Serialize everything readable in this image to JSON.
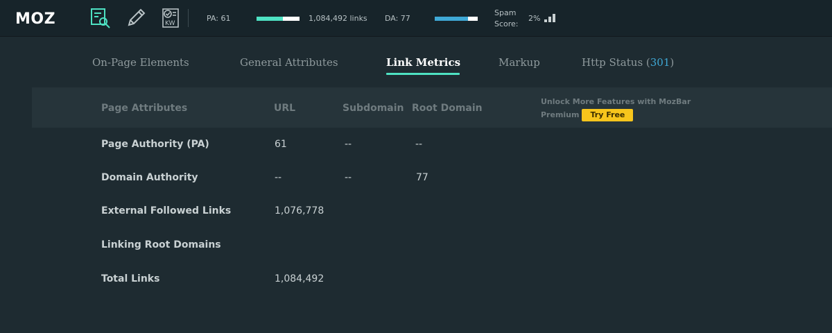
{
  "toolbar": {
    "logo": "MOZ",
    "pa_label": "PA: 61",
    "pa_fraction": 0.61,
    "links_label": "1,084,492 links",
    "da_label": "DA: 77",
    "da_fraction": 0.77,
    "spam_label_line1": "Spam",
    "spam_label_line2": "Score:",
    "spam_value": "2%",
    "icons": [
      "page-analysis-icon",
      "highlight-pencil-icon",
      "keyword-checklist-icon"
    ],
    "colors": {
      "pa_bar": "#4ee2c3",
      "da_bar": "#3fa9d6"
    }
  },
  "tabs": [
    {
      "label": "On-Page Elements"
    },
    {
      "label": "General Attributes"
    },
    {
      "label": "Link Metrics",
      "active": true
    },
    {
      "label": "Markup"
    },
    {
      "label": "Http Status (",
      "code": "301",
      "suffix": ")"
    }
  ],
  "table": {
    "headers": {
      "attributes": "Page Attributes",
      "url": "URL",
      "subdomain": "Subdomain",
      "root_domain": "Root Domain"
    },
    "unlock_line1": "Unlock More Features with MozBar",
    "unlock_line2": "Premium",
    "try_free": "Try Free",
    "rows": [
      {
        "label": "Page Authority (PA)",
        "url": "61",
        "subdomain": "--",
        "root": "--"
      },
      {
        "label": "Domain Authority",
        "url": "--",
        "subdomain": "--",
        "root": "77"
      },
      {
        "label": "External Followed Links",
        "url": "1,076,778",
        "subdomain": "",
        "root": ""
      },
      {
        "label": "Linking Root Domains",
        "url": "",
        "subdomain": "",
        "root": ""
      },
      {
        "label": "Total Links",
        "url": "1,084,492",
        "subdomain": "",
        "root": ""
      }
    ]
  }
}
